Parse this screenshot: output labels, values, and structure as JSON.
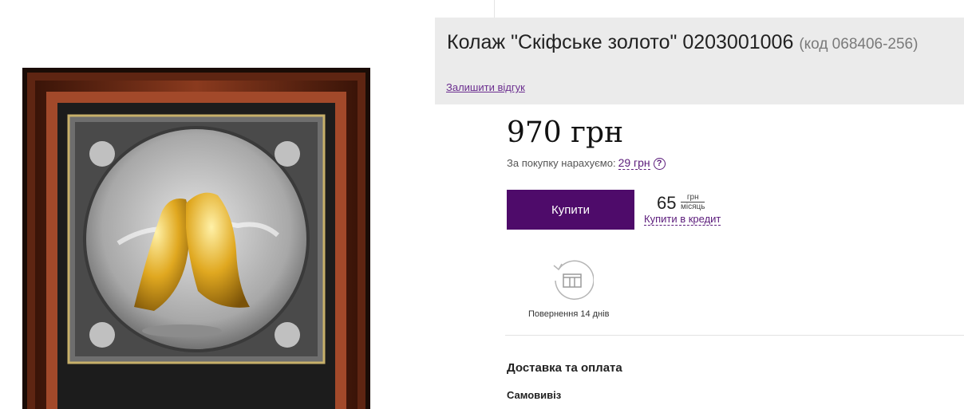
{
  "product": {
    "title": "Колаж \"Скіфське золото\" 0203001006",
    "code": "(код 068406-256)",
    "review_link": "Залишити відгук",
    "image_alt": "Колаж Скіфське золото"
  },
  "pricing": {
    "price": "970 грн",
    "bonus_label": "За покупку нарахуємо:",
    "bonus_value": "29 грн",
    "help_glyph": "?"
  },
  "actions": {
    "buy_label": "Купити"
  },
  "credit": {
    "amount": "65",
    "unit_top": "грн",
    "unit_bottom": "місяць",
    "link_label": "Купити в кредит"
  },
  "return_policy": {
    "label": "Повернення 14 днів",
    "icon": "return-box-icon"
  },
  "delivery": {
    "title": "Доставка та оплата",
    "pickup_label": "Самовивіз"
  },
  "colors": {
    "accent": "#4e0b6a",
    "link": "#6b2e8f",
    "title_bg": "#ebebeb"
  }
}
